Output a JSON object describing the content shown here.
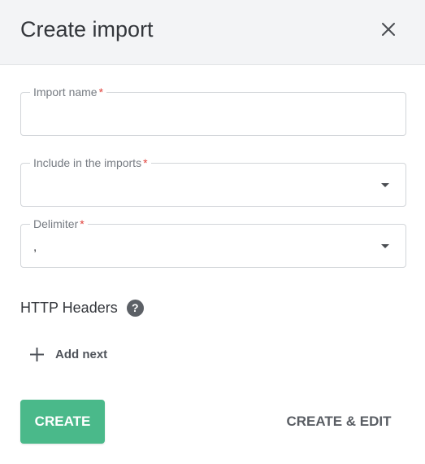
{
  "dialog": {
    "title": "Create import"
  },
  "fields": {
    "import_name": {
      "label": "Import name",
      "required_mark": "*",
      "value": ""
    },
    "include_in_imports": {
      "label": "Include in the imports",
      "required_mark": "*",
      "value": ""
    },
    "delimiter": {
      "label": "Delimiter",
      "required_mark": "*",
      "value": ","
    }
  },
  "http_headers": {
    "heading": "HTTP Headers",
    "help_glyph": "?",
    "add_next_label": "Add next"
  },
  "actions": {
    "create_label": "CREATE",
    "create_edit_label": "CREATE & EDIT"
  },
  "colors": {
    "primary": "#4ab98a",
    "required": "#e0413b",
    "header_bg": "#f3f4f6"
  },
  "icons": {
    "close": "close-icon",
    "dropdown": "chevron-down-icon",
    "help": "help-icon",
    "add": "plus-icon"
  }
}
